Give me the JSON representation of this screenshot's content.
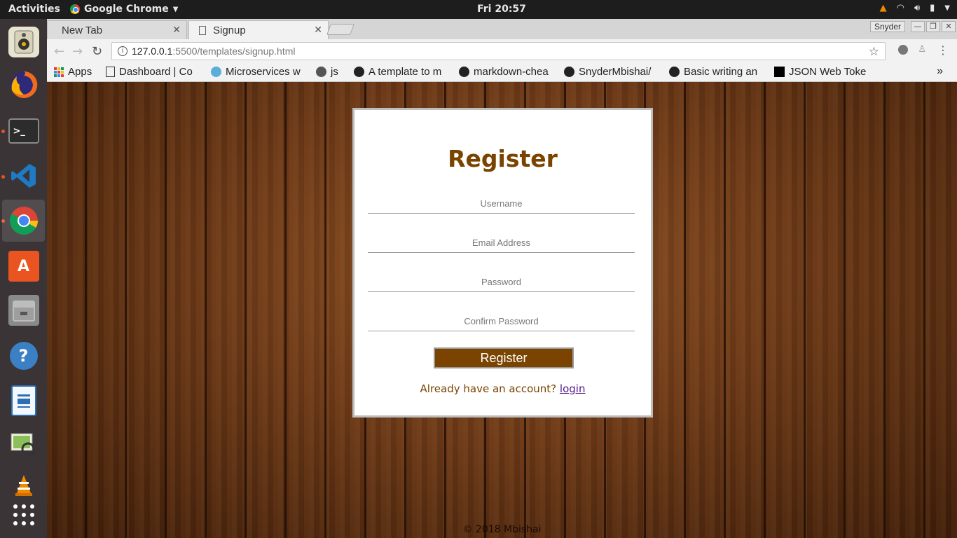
{
  "topbar": {
    "activities": "Activities",
    "app_name": "Google Chrome",
    "clock": "Fri 20:57"
  },
  "browser": {
    "tabs": [
      {
        "label": "New Tab"
      },
      {
        "label": "Signup"
      }
    ],
    "profile_name": "Snyder",
    "url_host": "127.0.0.1",
    "url_path": ":5500/templates/signup.html",
    "bookmarks": [
      {
        "label": "Apps",
        "icon": "apps-grid-icon"
      },
      {
        "label": "Dashboard | Co",
        "icon": "document-icon"
      },
      {
        "label": "Microservices w",
        "icon": "globe-icon"
      },
      {
        "label": "js",
        "icon": "circle-icon"
      },
      {
        "label": "A template to m",
        "icon": "github-icon"
      },
      {
        "label": "markdown-chea",
        "icon": "github-icon"
      },
      {
        "label": "SnyderMbishai/",
        "icon": "github-icon"
      },
      {
        "label": "Basic writing an",
        "icon": "github-icon"
      },
      {
        "label": "JSON Web Toke",
        "icon": "jwt-icon"
      }
    ],
    "bookmarks_overflow": "»"
  },
  "page": {
    "title": "Register",
    "fields": {
      "username_placeholder": "Username",
      "email_placeholder": "Email Address",
      "password_placeholder": "Password",
      "confirm_placeholder": "Confirm Password"
    },
    "register_button": "Register",
    "already_text": "Already have an account?",
    "login_link": "login",
    "footer": "© 2018 Mbishai"
  },
  "colors": {
    "accent_brown": "#7a4300",
    "ubuntu_orange": "#e95420"
  }
}
